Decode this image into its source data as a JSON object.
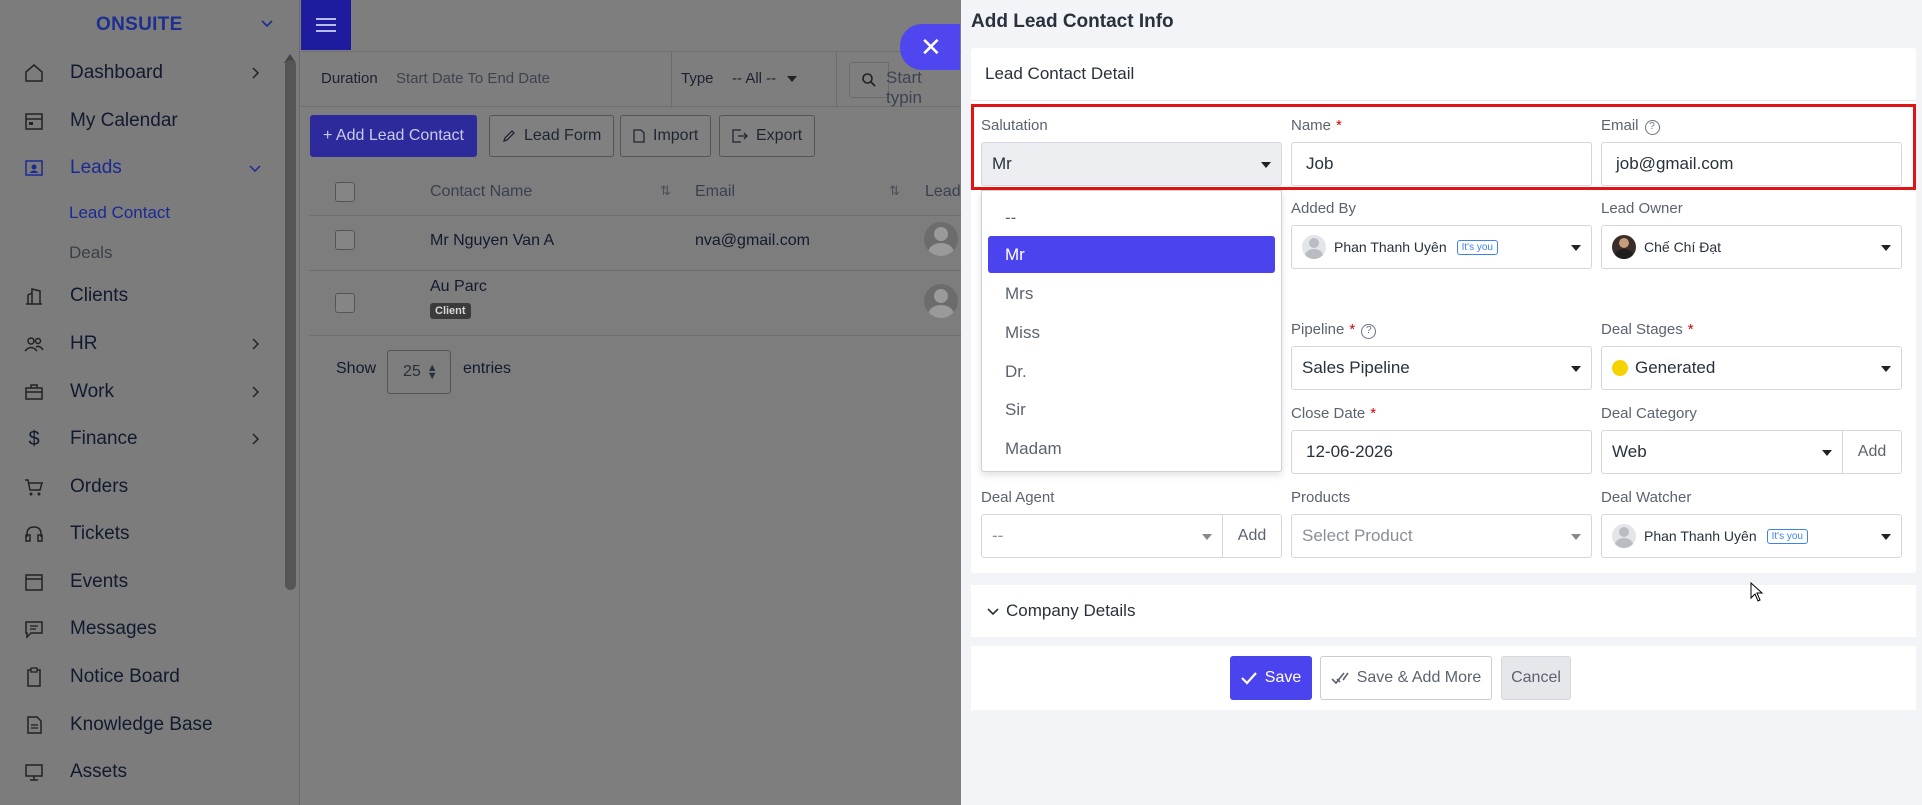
{
  "brand": {
    "name": "ONSUITE"
  },
  "sidebar": {
    "items": [
      {
        "label": "Dashboard",
        "icon": "home-icon",
        "has_arrow": true
      },
      {
        "label": "My Calendar",
        "icon": "calendar-icon",
        "has_arrow": false
      },
      {
        "label": "Leads",
        "icon": "leads-icon",
        "has_arrow": true,
        "expanded": true
      },
      {
        "label": "Clients",
        "icon": "building-icon",
        "has_arrow": false
      },
      {
        "label": "HR",
        "icon": "people-icon",
        "has_arrow": true
      },
      {
        "label": "Work",
        "icon": "briefcase-icon",
        "has_arrow": true
      },
      {
        "label": "Finance",
        "icon": "dollar-icon",
        "has_arrow": true
      },
      {
        "label": "Orders",
        "icon": "cart-icon",
        "has_arrow": false
      },
      {
        "label": "Tickets",
        "icon": "headset-icon",
        "has_arrow": false
      },
      {
        "label": "Events",
        "icon": "events-calendar-icon",
        "has_arrow": false
      },
      {
        "label": "Messages",
        "icon": "message-icon",
        "has_arrow": false
      },
      {
        "label": "Notice Board",
        "icon": "clipboard-icon",
        "has_arrow": false
      },
      {
        "label": "Knowledge Base",
        "icon": "document-icon",
        "has_arrow": false
      },
      {
        "label": "Assets",
        "icon": "monitor-icon",
        "has_arrow": false
      }
    ],
    "sub_items": [
      {
        "label": "Lead Contact",
        "active": true
      },
      {
        "label": "Deals",
        "active": false
      }
    ]
  },
  "filters": {
    "duration_label": "Duration",
    "duration_value": "Start Date To End Date",
    "type_label": "Type",
    "type_value": "-- All --",
    "search_placeholder": "Start typin"
  },
  "toolbar": {
    "add_label": "+ Add Lead Contact",
    "form_label": "Lead Form",
    "import_label": "Import",
    "export_label": "Export"
  },
  "table": {
    "headers": [
      "Contact Name",
      "Email",
      "Lead"
    ],
    "rows": [
      {
        "name": "Mr Nguyen Van A",
        "email": "nva@gmail.com",
        "badge": ""
      },
      {
        "name": "Au Parc",
        "email": "",
        "badge": "Client"
      }
    ],
    "show_label": "Show",
    "entries_value": "25",
    "entries_label": "entries"
  },
  "panel": {
    "title": "Add Lead Contact Info",
    "section_title": "Lead Contact Detail",
    "labels": {
      "salutation": "Salutation",
      "name": "Name",
      "email": "Email",
      "added_by": "Added By",
      "lead_owner": "Lead Owner",
      "pipeline": "Pipeline",
      "deal_stages": "Deal Stages",
      "close_date": "Close Date",
      "deal_category": "Deal Category",
      "deal_agent": "Deal Agent",
      "products": "Products",
      "deal_watcher": "Deal Watcher"
    },
    "values": {
      "salutation": "Mr",
      "name": "Job",
      "email": "job@gmail.com",
      "added_by": "Phan Thanh Uyên",
      "added_by_badge": "It's you",
      "lead_owner": "Chế Chí Đạt",
      "pipeline": "Sales Pipeline",
      "deal_stage": "Generated",
      "close_date": "12-06-2026",
      "deal_category": "Web",
      "deal_agent": "--",
      "products_placeholder": "Select Product",
      "deal_watcher": "Phan Thanh Uyên",
      "deal_watcher_badge": "It's you"
    },
    "add_label": "Add",
    "salutation_options": [
      "--",
      "Mr",
      "Mrs",
      "Miss",
      "Dr.",
      "Sir",
      "Madam"
    ],
    "salutation_selected": "Mr",
    "company_section": "Company Details",
    "buttons": {
      "save": "Save",
      "save_more": "Save & Add More",
      "cancel": "Cancel"
    }
  },
  "colors": {
    "primary": "#4b43ee",
    "highlight": "#e01414",
    "required": "#d30000",
    "stage_dot": "#f5d300"
  }
}
